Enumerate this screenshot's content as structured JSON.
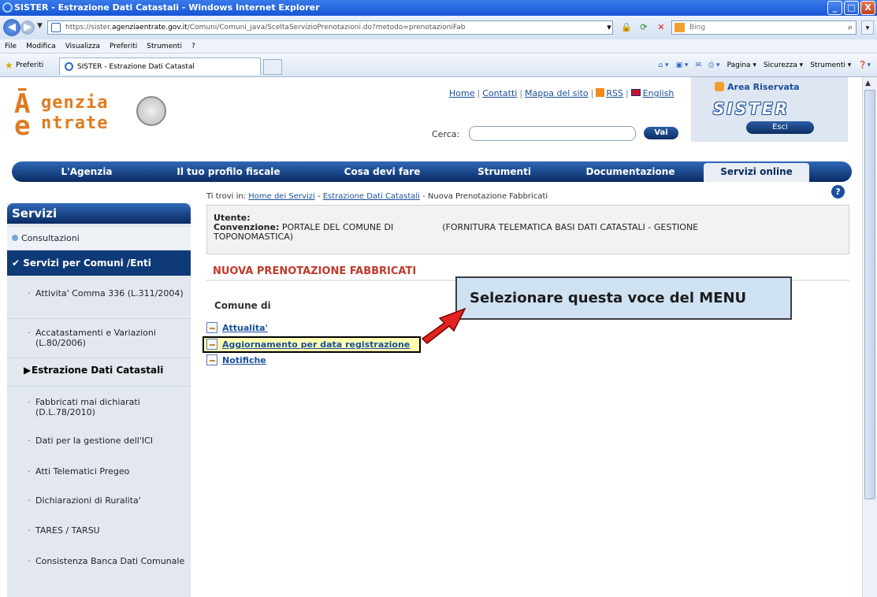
{
  "window": {
    "title": "SISTER - Estrazione Dati Catastali - Windows Internet Explorer",
    "controls": [
      "_",
      "□",
      "X"
    ]
  },
  "address": {
    "url_prefix": "https://sister.",
    "url_domain": "agenziaentrate.gov.it",
    "url_path": "/Comuni/Comuni_java/SceltaServizioPrenotazioni.do?metodo=prenotazioniFab",
    "search_placeholder": "Bing"
  },
  "menubar": [
    "File",
    "Modifica",
    "Visualizza",
    "Preferiti",
    "Strumenti",
    "?"
  ],
  "favbar": {
    "favorites": "Preferiti",
    "tab_title": "SISTER - Estrazione Dati Catastal",
    "commands": [
      "Pagina ▾",
      "Sicurezza ▾",
      "Strumenti ▾"
    ]
  },
  "header": {
    "logo_line1": "genzia",
    "logo_line2": "ntrate",
    "links": [
      "Home",
      "Contatti",
      "Mappa del sito",
      "RSS",
      "English"
    ],
    "search_label": "Cerca:",
    "search_button": "Vai",
    "area_title": "Area Riservata",
    "sister_logo": "SISTER",
    "logout_button": "Esci"
  },
  "mainnav": [
    "L'Agenzia",
    "Il tuo profilo fiscale",
    "Cosa devi fare",
    "Strumenti",
    "Documentazione",
    "Servizi online"
  ],
  "sidebar": {
    "title": "Servizi",
    "consultazioni": "Consultazioni",
    "group": "Servizi per Comuni /Enti",
    "items": [
      "Attivita' Comma 336 (L.311/2004)",
      "Accatastamenti e Variazioni (L.80/2006)",
      "Estrazione Dati Catastali",
      "Fabbricati mai dichiarati (D.L.78/2010)",
      "Dati per la gestione dell'ICI",
      "Atti Telematici Pregeo",
      "Dichiarazioni di Ruralita'",
      "TARES / TARSU",
      "Consistenza Banca Dati Comunale"
    ]
  },
  "content": {
    "breadcrumb_prefix": "Ti trovi in:",
    "breadcrumb": [
      "Home dei Servizi",
      "Estrazione Dati Catastali",
      "Nuova Prenotazione Fabbricati"
    ],
    "utente_label": "Utente:",
    "convenzione_label": "Convenzione:",
    "convenzione_value": "PORTALE DEL COMUNE DI",
    "convenzione_tail": "(FORNITURA TELEMATICA BASI DATI CATASTALI - GESTIONE",
    "convenzione_line2": "TOPONOMASTICA)",
    "section_title": "NUOVA PRENOTAZIONE FABBRICATI",
    "comune_label": "Comune di",
    "links": [
      "Attualita'",
      "Aggiornamento per data registrazione",
      "Notifiche"
    ]
  },
  "callout": "Selezionare questa  voce del MENU"
}
